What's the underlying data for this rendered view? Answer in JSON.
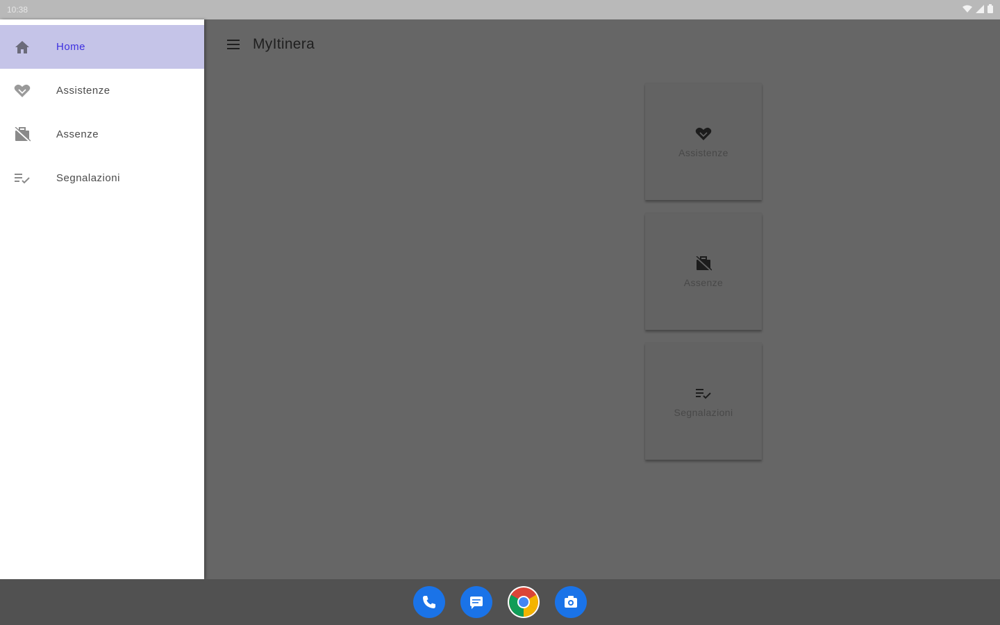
{
  "status_bar": {
    "time": "10:38",
    "icons": [
      "wifi-icon",
      "signal-icon",
      "battery-icon"
    ]
  },
  "app": {
    "title": "MyItinera",
    "menu_icon": "hamburger-menu-icon"
  },
  "drawer": {
    "items": [
      {
        "label": "Home",
        "icon": "home-icon",
        "active": true
      },
      {
        "label": "Assistenze",
        "icon": "handshake-heart-icon",
        "active": false
      },
      {
        "label": "Assenze",
        "icon": "work-off-icon",
        "active": false
      },
      {
        "label": "Segnalazioni",
        "icon": "playlist-check-icon",
        "active": false
      }
    ]
  },
  "cards": [
    {
      "label": "Assistenze",
      "icon": "handshake-heart-icon"
    },
    {
      "label": "Assenze",
      "icon": "work-off-icon"
    },
    {
      "label": "Segnalazioni",
      "icon": "playlist-check-icon"
    }
  ],
  "dock": {
    "apps": [
      "phone-icon",
      "messages-icon",
      "chrome-icon",
      "camera-icon"
    ]
  },
  "colors": {
    "accent": "#3d2fe0",
    "active_bg": "#c5c4e8",
    "scrim": "#666666",
    "dock_blue": "#1a73e8"
  }
}
